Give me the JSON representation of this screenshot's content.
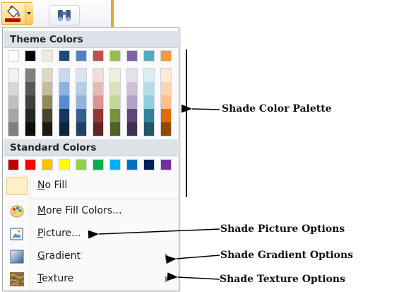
{
  "menu": {
    "theme_header": "Theme Colors",
    "standard_header": "Standard Colors",
    "theme_base": [
      "#ffffff",
      "#000000",
      "#eeece1",
      "#1f497d",
      "#4f81bd",
      "#c0504d",
      "#9bbb59",
      "#8064a2",
      "#4bacc6",
      "#f79646"
    ],
    "theme_shades": [
      [
        "#f2f2f2",
        "#d8d8d8",
        "#bfbfbf",
        "#a5a5a5",
        "#7f7f7f"
      ],
      [
        "#7f7f7f",
        "#595959",
        "#3f3f3f",
        "#262626",
        "#0c0c0c"
      ],
      [
        "#ddd9c3",
        "#c4bd97",
        "#938953",
        "#494429",
        "#1d1b10"
      ],
      [
        "#c6d9f0",
        "#8db3e2",
        "#548dd4",
        "#17365d",
        "#0f243e"
      ],
      [
        "#dbe5f1",
        "#b8cce4",
        "#95b3d7",
        "#366092",
        "#244061"
      ],
      [
        "#f2dcdb",
        "#e5b9b7",
        "#d99694",
        "#953734",
        "#632423"
      ],
      [
        "#ebf1dd",
        "#d7e3bc",
        "#c3d69b",
        "#76923c",
        "#4f6128"
      ],
      [
        "#e5e0ec",
        "#ccc1d9",
        "#b2a2c7",
        "#5f497a",
        "#3f3151"
      ],
      [
        "#dbeef3",
        "#b7dde8",
        "#92cddc",
        "#31859b",
        "#205867"
      ],
      [
        "#fdeada",
        "#fbd5b5",
        "#fac08f",
        "#e36c09",
        "#974806"
      ]
    ],
    "standard": [
      "#c00000",
      "#ff0000",
      "#ffc000",
      "#ffff00",
      "#92d050",
      "#00b050",
      "#00b0f0",
      "#0070c0",
      "#002060",
      "#7030a0"
    ],
    "items": {
      "no_fill": {
        "key": "N",
        "rest": "o Fill"
      },
      "more_colors": {
        "key": "M",
        "rest": "ore Fill Colors..."
      },
      "picture": {
        "key": "P",
        "rest": "icture..."
      },
      "gradient": {
        "key": "G",
        "rest": "radient"
      },
      "texture": {
        "key": "T",
        "rest": "exture"
      }
    }
  },
  "annotations": {
    "palette": "Shade Color Palette",
    "picture": "Shade Picture Options",
    "gradient": "Shade Gradient Options",
    "texture": "Shade Texture Options"
  },
  "icons": [
    "paint-bucket-icon",
    "binoculars-icon",
    "no-fill-swatch-icon",
    "color-palette-icon",
    "picture-icon",
    "gradient-icon",
    "texture-icon"
  ]
}
